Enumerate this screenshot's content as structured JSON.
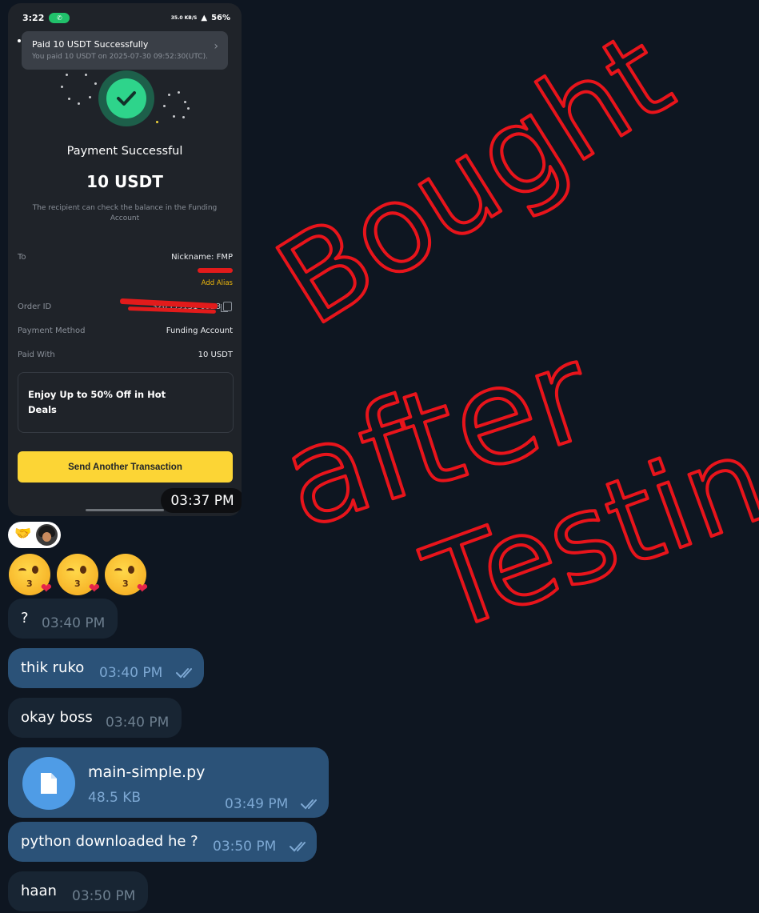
{
  "phone": {
    "status_time": "3:22",
    "status_net": "35.0 KB/S",
    "status_battery": "56%",
    "notification": {
      "title": "Paid 10 USDT Successfully",
      "subtitle": "You paid 10 USDT on 2025-07-30 09:52:30(UTC)."
    },
    "payment_title": "Payment Successful",
    "amount": "10 USDT",
    "note": "The recipient can check the balance in the Funding Account",
    "details": {
      "to_label": "To",
      "to_value": "Nickname: FMP",
      "add_alias": "Add Alias",
      "order_label": "Order ID",
      "order_value": "320339131 0928",
      "method_label": "Payment Method",
      "method_value": "Funding Account",
      "paid_label": "Paid With",
      "paid_value": "10 USDT"
    },
    "promo": "Enjoy Up to 50% Off in Hot Deals",
    "send_button": "Send Another Transaction",
    "bubble_time": "03:37 PM"
  },
  "reaction": {
    "emoji": "🤝"
  },
  "messages": [
    {
      "id": "m1",
      "type": "in",
      "text": "?",
      "time": "03:40 PM"
    },
    {
      "id": "m2",
      "type": "out",
      "text": "thik ruko",
      "time": "03:40 PM"
    },
    {
      "id": "m3",
      "type": "in",
      "text": "okay boss",
      "time": "03:40 PM"
    },
    {
      "id": "m5",
      "type": "out",
      "text": "python downloaded he ?",
      "time": "03:50 PM"
    },
    {
      "id": "m6",
      "type": "in",
      "text": "haan",
      "time": "03:50 PM"
    }
  ],
  "file": {
    "name": "main-simple.py",
    "size": "48.5 KB",
    "time": "03:49 PM"
  },
  "annotation": {
    "line1": "Bought",
    "line2": "after",
    "line3": "Testing"
  },
  "colors": {
    "background": "#0e1621",
    "incoming": "#182533",
    "outgoing": "#2b5278",
    "annotation": "#e8141b",
    "binance_yellow": "#fcd535"
  }
}
